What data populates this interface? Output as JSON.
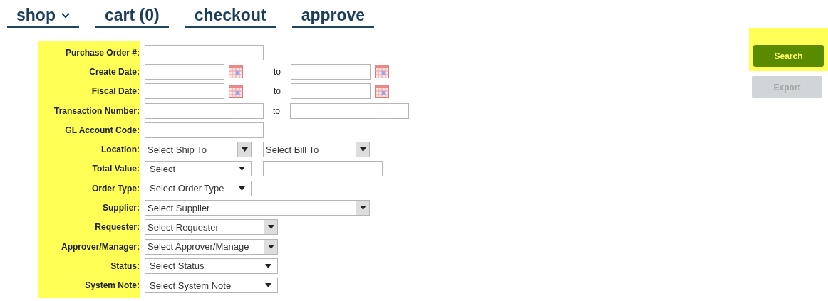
{
  "nav": [
    {
      "label": "shop",
      "caret": true
    },
    {
      "label": "cart (0)",
      "caret": false
    },
    {
      "label": "checkout",
      "caret": false
    },
    {
      "label": "approve",
      "caret": false
    }
  ],
  "form": {
    "rows": [
      {
        "label": "Purchase Order #:",
        "controls": [
          {
            "kind": "text"
          }
        ]
      },
      {
        "label": "Create Date:",
        "controls": [
          {
            "kind": "date"
          },
          {
            "kind": "to",
            "text": "to"
          },
          {
            "kind": "date"
          }
        ]
      },
      {
        "label": "Fiscal Date:",
        "controls": [
          {
            "kind": "date"
          },
          {
            "kind": "to",
            "text": "to"
          },
          {
            "kind": "date"
          }
        ]
      },
      {
        "label": "Transaction Number:",
        "controls": [
          {
            "kind": "text"
          },
          {
            "kind": "to",
            "text": "to"
          },
          {
            "kind": "text"
          }
        ]
      },
      {
        "label": "GL Account Code:",
        "controls": [
          {
            "kind": "text"
          }
        ]
      },
      {
        "label": "Location:",
        "controls": [
          {
            "kind": "combo",
            "value": "Select Ship To"
          },
          {
            "kind": "combo",
            "value": "Select Bill To"
          }
        ]
      },
      {
        "label": "Total Value:",
        "controls": [
          {
            "kind": "select",
            "value": "Select"
          },
          {
            "kind": "text"
          }
        ]
      },
      {
        "label": "Order Type:",
        "controls": [
          {
            "kind": "select",
            "value": "Select Order Type"
          }
        ]
      },
      {
        "label": "Supplier:",
        "controls": [
          {
            "kind": "combo",
            "value": "Select Supplier"
          }
        ]
      },
      {
        "label": "Requester:",
        "controls": [
          {
            "kind": "combo",
            "value": "Select Requester"
          }
        ]
      },
      {
        "label": "Approver/Manager:",
        "controls": [
          {
            "kind": "combo",
            "value": "Select Approver/Manage"
          }
        ]
      },
      {
        "label": "Status:",
        "controls": [
          {
            "kind": "select",
            "value": "Select Status"
          }
        ]
      },
      {
        "label": "System Note:",
        "controls": [
          {
            "kind": "select",
            "value": "Select System Note"
          }
        ]
      }
    ]
  },
  "actions": [
    {
      "label": "Search",
      "disabled": false
    },
    {
      "label": "Export",
      "disabled": true
    }
  ]
}
